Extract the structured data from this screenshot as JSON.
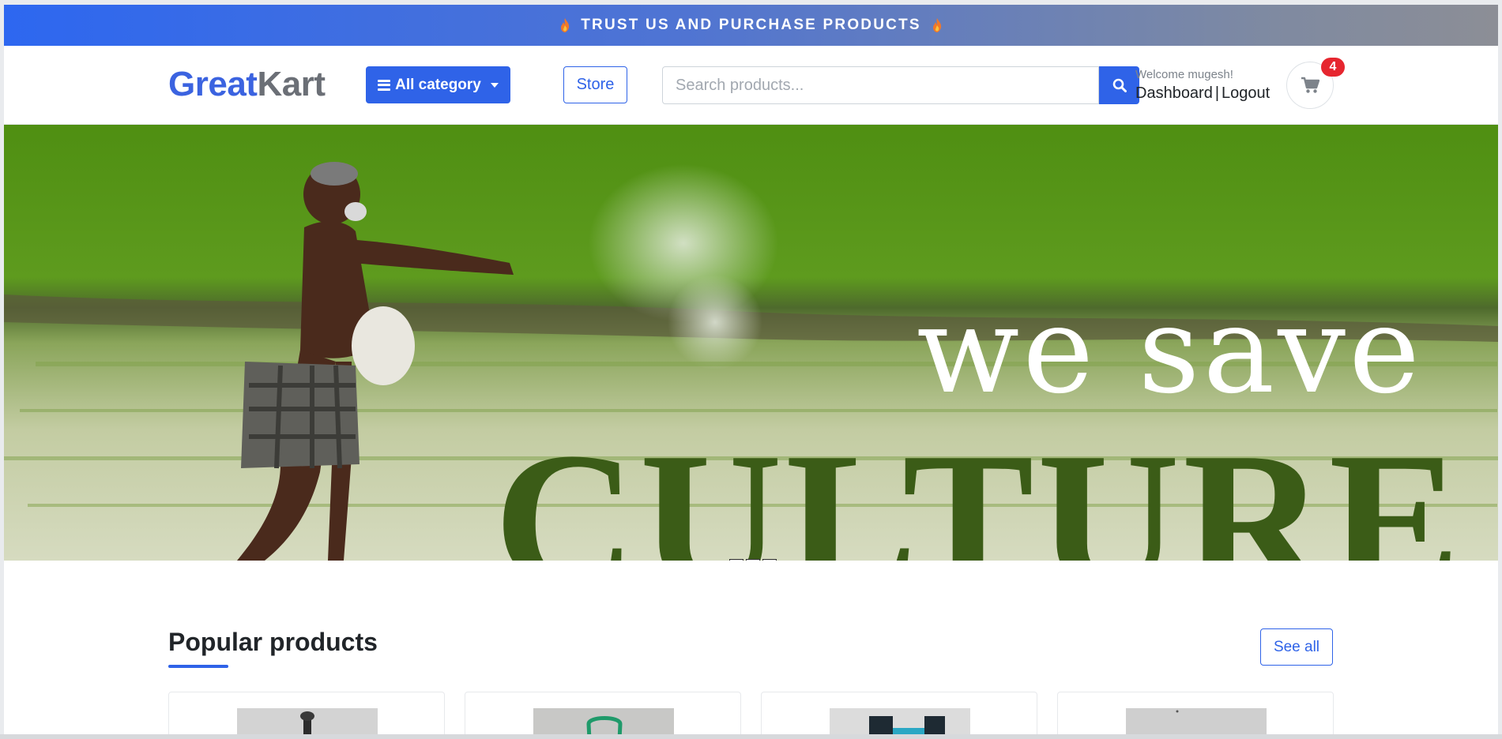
{
  "promo": {
    "text": "TRUST US AND PURCHASE PRODUCTS",
    "icon_left": "flame-icon",
    "icon_right": "flame-icon"
  },
  "header": {
    "logo": {
      "part1": "Great",
      "part2": "Kart"
    },
    "category_button": {
      "label": "All category",
      "icon": "hamburger-icon"
    },
    "store_button": "Store",
    "search": {
      "placeholder": "Search products...",
      "value": "",
      "button_icon": "search-icon"
    },
    "user": {
      "welcome": "Welcome mugesh!",
      "dashboard": "Dashboard",
      "separator": "|",
      "logout": "Logout"
    },
    "cart": {
      "icon": "cart-icon",
      "count": "4"
    }
  },
  "hero": {
    "line1": "we save",
    "line2": "CULTURE"
  },
  "popular": {
    "title": "Popular products",
    "see_all": "See all",
    "products": [
      {
        "image": "product-image"
      },
      {
        "image": "product-image"
      },
      {
        "image": "product-image"
      },
      {
        "image": "product-image"
      }
    ]
  },
  "colors": {
    "accent": "#2f63e8",
    "badge": "#e6262f",
    "hero_text_dark": "#3b5c17",
    "logo_gray": "#6b6f76"
  }
}
